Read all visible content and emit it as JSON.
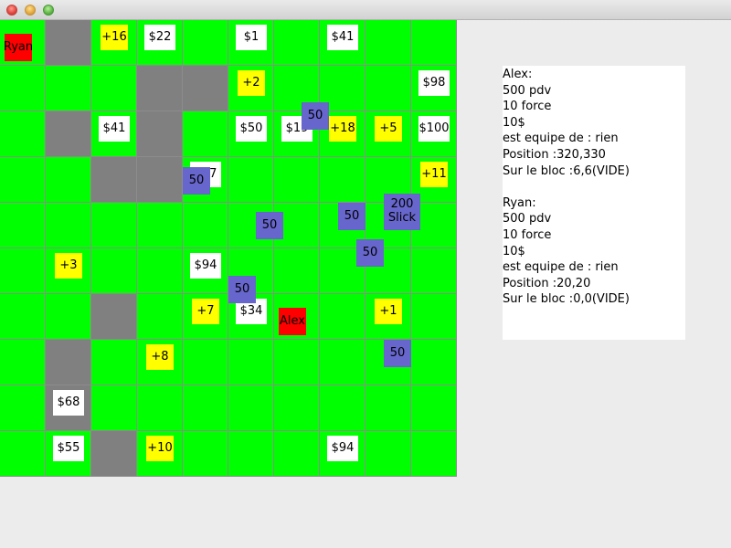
{
  "window": {
    "title": ""
  },
  "colors": {
    "floor": "#00ff00",
    "wall": "#808080",
    "money": "#ffffff",
    "bonus": "#ffff00",
    "player": "#ff0000",
    "monster": "#6666cc"
  },
  "board": {
    "cols": 10,
    "rows": 10,
    "walls": [
      [
        1,
        0
      ],
      [
        1,
        2
      ],
      [
        1,
        7
      ],
      [
        1,
        8
      ],
      [
        2,
        3
      ],
      [
        2,
        6
      ],
      [
        2,
        9
      ],
      [
        3,
        1
      ],
      [
        3,
        2
      ],
      [
        3,
        3
      ],
      [
        4,
        1
      ]
    ],
    "money": [
      {
        "label": "$22",
        "col": 3,
        "row": 0
      },
      {
        "label": "$1",
        "col": 5,
        "row": 0
      },
      {
        "label": "$41",
        "col": 7,
        "row": 0
      },
      {
        "label": "$98",
        "col": 9,
        "row": 1
      },
      {
        "label": "$41",
        "col": 2,
        "row": 2
      },
      {
        "label": "$50",
        "col": 5,
        "row": 2
      },
      {
        "label": "$19",
        "col": 6,
        "row": 2
      },
      {
        "label": "$100",
        "col": 9,
        "row": 2
      },
      {
        "label": "$17",
        "col": 4,
        "row": 3
      },
      {
        "label": "$94",
        "col": 4,
        "row": 5
      },
      {
        "label": "$34",
        "col": 5,
        "row": 6
      },
      {
        "label": "$68",
        "col": 1,
        "row": 8
      },
      {
        "label": "$55",
        "col": 1,
        "row": 9
      },
      {
        "label": "$94",
        "col": 7,
        "row": 9
      }
    ],
    "bonuses": [
      {
        "label": "+16",
        "col": 2,
        "row": 0
      },
      {
        "label": "+2",
        "col": 5,
        "row": 1
      },
      {
        "label": "+18",
        "col": 7,
        "row": 2
      },
      {
        "label": "+5",
        "col": 8,
        "row": 2
      },
      {
        "label": "+11",
        "col": 9,
        "row": 3
      },
      {
        "label": "+3",
        "col": 1,
        "row": 5
      },
      {
        "label": "+7",
        "col": 4,
        "row": 6
      },
      {
        "label": "+1",
        "col": 8,
        "row": 6
      },
      {
        "label": "+8",
        "col": 3,
        "row": 7
      },
      {
        "label": "+10",
        "col": 3,
        "row": 9
      }
    ],
    "players": [
      {
        "name": "Ryan",
        "col": 0,
        "row": 0
      },
      {
        "name": "Alex",
        "col": 6,
        "row": 6
      }
    ],
    "monsters": [
      {
        "label": "50",
        "col": 4,
        "row": 3,
        "big": false
      },
      {
        "label": "50",
        "col": 6,
        "row": 2,
        "big": false
      },
      {
        "label": "50",
        "col": 5,
        "row": 4,
        "big": false
      },
      {
        "label": "50",
        "col": 7,
        "row": 4,
        "big": false
      },
      {
        "label": "50",
        "col": 7,
        "row": 5,
        "big": false
      },
      {
        "label": "200\nSlick",
        "col": 8,
        "row": 4,
        "big": true
      },
      {
        "label": "50",
        "col": 5,
        "row": 6,
        "big": false
      },
      {
        "label": "50",
        "col": 8,
        "row": 7,
        "big": false
      }
    ]
  },
  "info_panel": {
    "lines": [
      "Alex:",
      "500 pdv",
      "10 force",
      "10$",
      "est equipe de : rien",
      "Position :320,330",
      "Sur le bloc :6,6(VIDE)",
      "",
      "Ryan:",
      "500 pdv",
      "10 force",
      "10$",
      "est equipe de : rien",
      "Position :20,20",
      "Sur le bloc :0,0(VIDE)"
    ]
  }
}
